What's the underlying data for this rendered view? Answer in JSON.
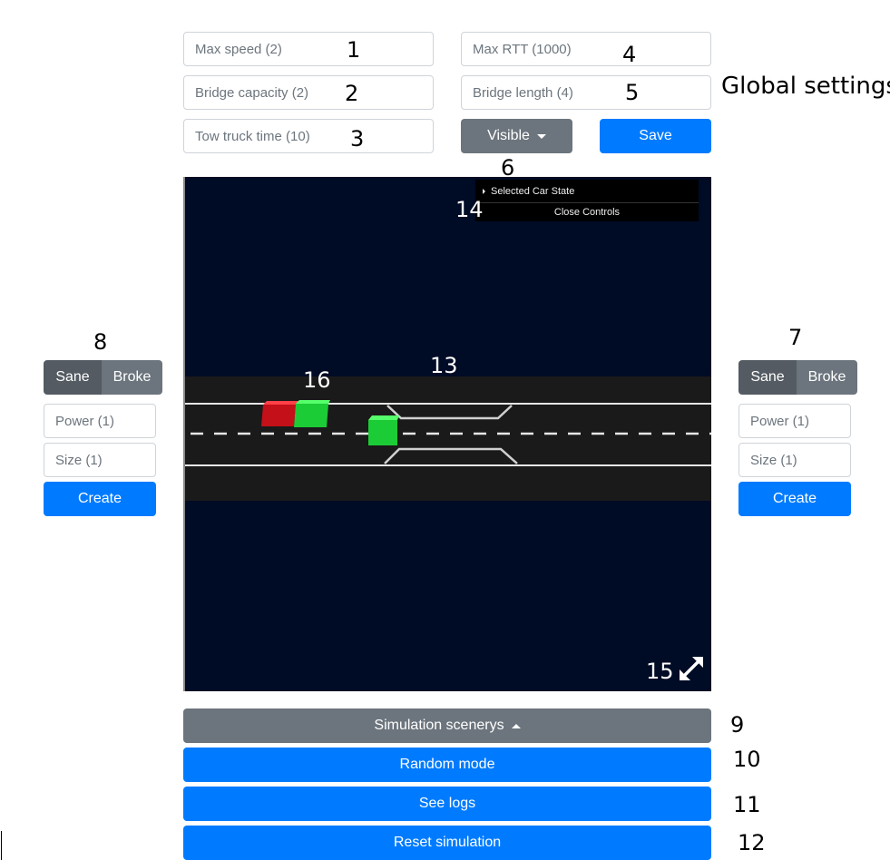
{
  "global": {
    "title": "Global settings",
    "max_speed_placeholder": "Max speed (2)",
    "bridge_capacity_placeholder": "Bridge capacity (2)",
    "tow_truck_time_placeholder": "Tow truck time (10)",
    "max_rtt_placeholder": "Max RTT (1000)",
    "bridge_length_placeholder": "Bridge length (4)",
    "visibility_label": "Visible",
    "save_label": "Save"
  },
  "left_panel": {
    "sane_label": "Sane",
    "broke_label": "Broke",
    "power_placeholder": "Power (1)",
    "size_placeholder": "Size (1)",
    "create_label": "Create"
  },
  "right_panel": {
    "sane_label": "Sane",
    "broke_label": "Broke",
    "power_placeholder": "Power (1)",
    "size_placeholder": "Size (1)",
    "create_label": "Create"
  },
  "simulation": {
    "gui_selected_car_state": "Selected Car State",
    "gui_close_controls": "Close Controls",
    "background_color": "#000b25",
    "road_color": "#1a1a1a",
    "cars": [
      {
        "color": "red",
        "hex": "#e0202a"
      },
      {
        "color": "green",
        "hex": "#1ee23a"
      },
      {
        "color": "green",
        "hex": "#1ee23a"
      }
    ]
  },
  "bottom": {
    "scenarios_label": "Simulation scenerys",
    "random_mode_label": "Random mode",
    "see_logs_label": "See logs",
    "reset_label": "Reset simulation"
  },
  "annotations": {
    "n1": "1",
    "n2": "2",
    "n3": "3",
    "n4": "4",
    "n5": "5",
    "n6": "6",
    "n7": "7",
    "n8": "8",
    "n9": "9",
    "n10": "10",
    "n11": "11",
    "n12": "12",
    "n13": "13",
    "n14": "14",
    "n15": "15",
    "n16": "16"
  },
  "colors": {
    "primary": "#007bff",
    "secondary": "#6c757d",
    "secondary_active": "#545b62"
  }
}
